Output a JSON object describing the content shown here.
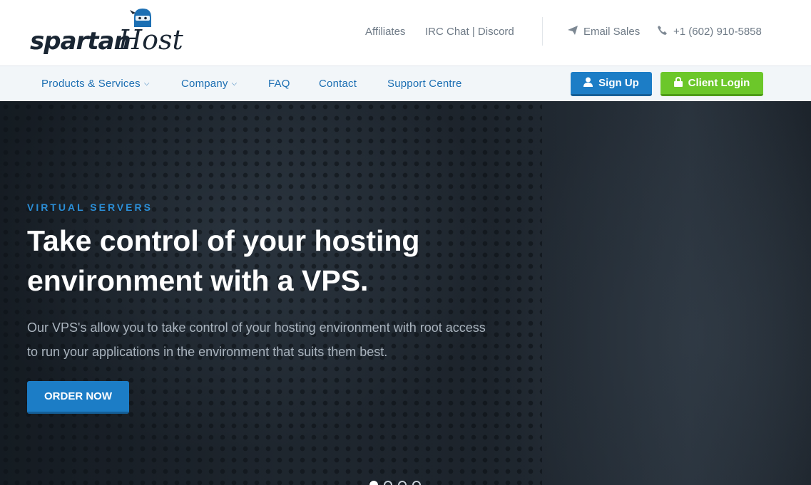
{
  "brand": {
    "logo_text_1": "spartan",
    "logo_text_2": "Host",
    "logo_color": "#1a2633",
    "mascot_icon": "ninja-mascot-icon"
  },
  "top_links": {
    "affiliates": "Affiliates",
    "irc_chat": "IRC Chat | Discord",
    "email_sales": "Email Sales",
    "phone": "+1 (602) 910-5858",
    "email_icon": "paper-plane-icon",
    "phone_icon": "phone-icon"
  },
  "nav": {
    "items": [
      {
        "label": "Products & Services",
        "has_dropdown": true
      },
      {
        "label": "Company",
        "has_dropdown": true
      },
      {
        "label": "FAQ",
        "has_dropdown": false
      },
      {
        "label": "Contact",
        "has_dropdown": false
      },
      {
        "label": "Support Centre",
        "has_dropdown": false
      }
    ],
    "signup_label": "Sign Up",
    "signup_icon": "user-icon",
    "login_label": "Client Login",
    "login_icon": "lock-icon",
    "link_color": "#1c6fb3",
    "signup_color": "#1c7dc6",
    "login_color": "#6cc72a"
  },
  "hero": {
    "eyebrow": "VIRTUAL SERVERS",
    "headline": "Take control of your hosting environment with a VPS.",
    "subtext": "Our VPS's allow you to take control of your hosting environment with root access to run your applications in the environment that suits them best.",
    "cta_label": "ORDER NOW",
    "accent_color": "#2b8ed6",
    "slides": [
      true,
      false,
      false,
      false
    ]
  }
}
